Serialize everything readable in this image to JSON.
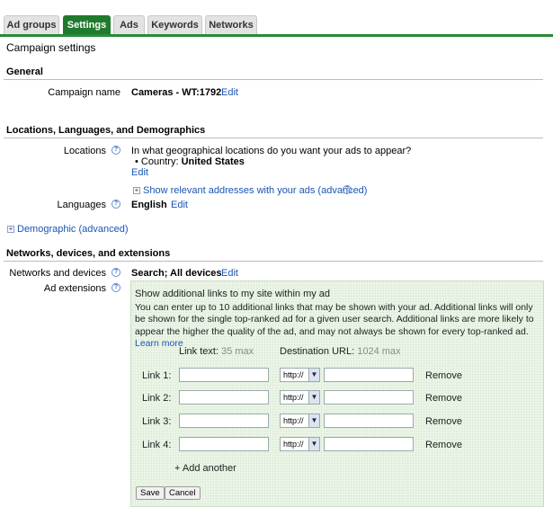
{
  "tabs": [
    {
      "label": "Ad groups",
      "active": false
    },
    {
      "label": "Settings",
      "active": true
    },
    {
      "label": "Ads",
      "active": false
    },
    {
      "label": "Keywords",
      "active": false
    },
    {
      "label": "Networks",
      "active": false
    }
  ],
  "page_title": "Campaign settings",
  "general": {
    "heading": "General",
    "campaign_name_label": "Campaign name",
    "campaign_name_value": "Cameras - WT:1792",
    "edit": "Edit"
  },
  "locations_section": {
    "heading": "Locations, Languages, and Demographics",
    "locations_label": "Locations",
    "question": "In what geographical locations do you want your ads to appear?",
    "country_prefix": "Country:",
    "country_value": "United States",
    "edit": "Edit",
    "show_addresses": "Show relevant addresses with your ads (advanced)",
    "languages_label": "Languages",
    "languages_value": "English",
    "languages_edit": "Edit",
    "demographic": "Demographic (advanced)"
  },
  "networks_section": {
    "heading": "Networks, devices, and extensions",
    "networks_label": "Networks and devices",
    "networks_value": "Search; All devices",
    "networks_edit": "Edit",
    "ad_ext_label": "Ad extensions"
  },
  "ad_extensions_panel": {
    "title": "Show additional links to my site within my ad",
    "description": "You can enter up to 10 additional links that may be shown with your ad. Additional links will only be shown for the single top-ranked ad for a given user search. Additional links are more likely to appear the higher the quality of the ad, and may not always be shown for every top-ranked ad.",
    "learn_more": "Learn more",
    "link_text_header": "Link text:",
    "link_text_max": "35 max",
    "dest_url_header": "Destination URL:",
    "dest_url_max": "1024 max",
    "links": [
      {
        "label": "Link 1:",
        "text": "",
        "protocol": "http://",
        "url": "",
        "remove": "Remove"
      },
      {
        "label": "Link 2:",
        "text": "",
        "protocol": "http://",
        "url": "",
        "remove": "Remove"
      },
      {
        "label": "Link 3:",
        "text": "",
        "protocol": "http://",
        "url": "",
        "remove": "Remove"
      },
      {
        "label": "Link 4:",
        "text": "",
        "protocol": "http://",
        "url": "",
        "remove": "Remove"
      }
    ],
    "add_another": "+ Add another",
    "save": "Save",
    "cancel": "Cancel"
  },
  "colors": {
    "active_tab": "#1f7a2e",
    "link": "#1a55b3",
    "panel_bg": "#eaf4e6"
  }
}
